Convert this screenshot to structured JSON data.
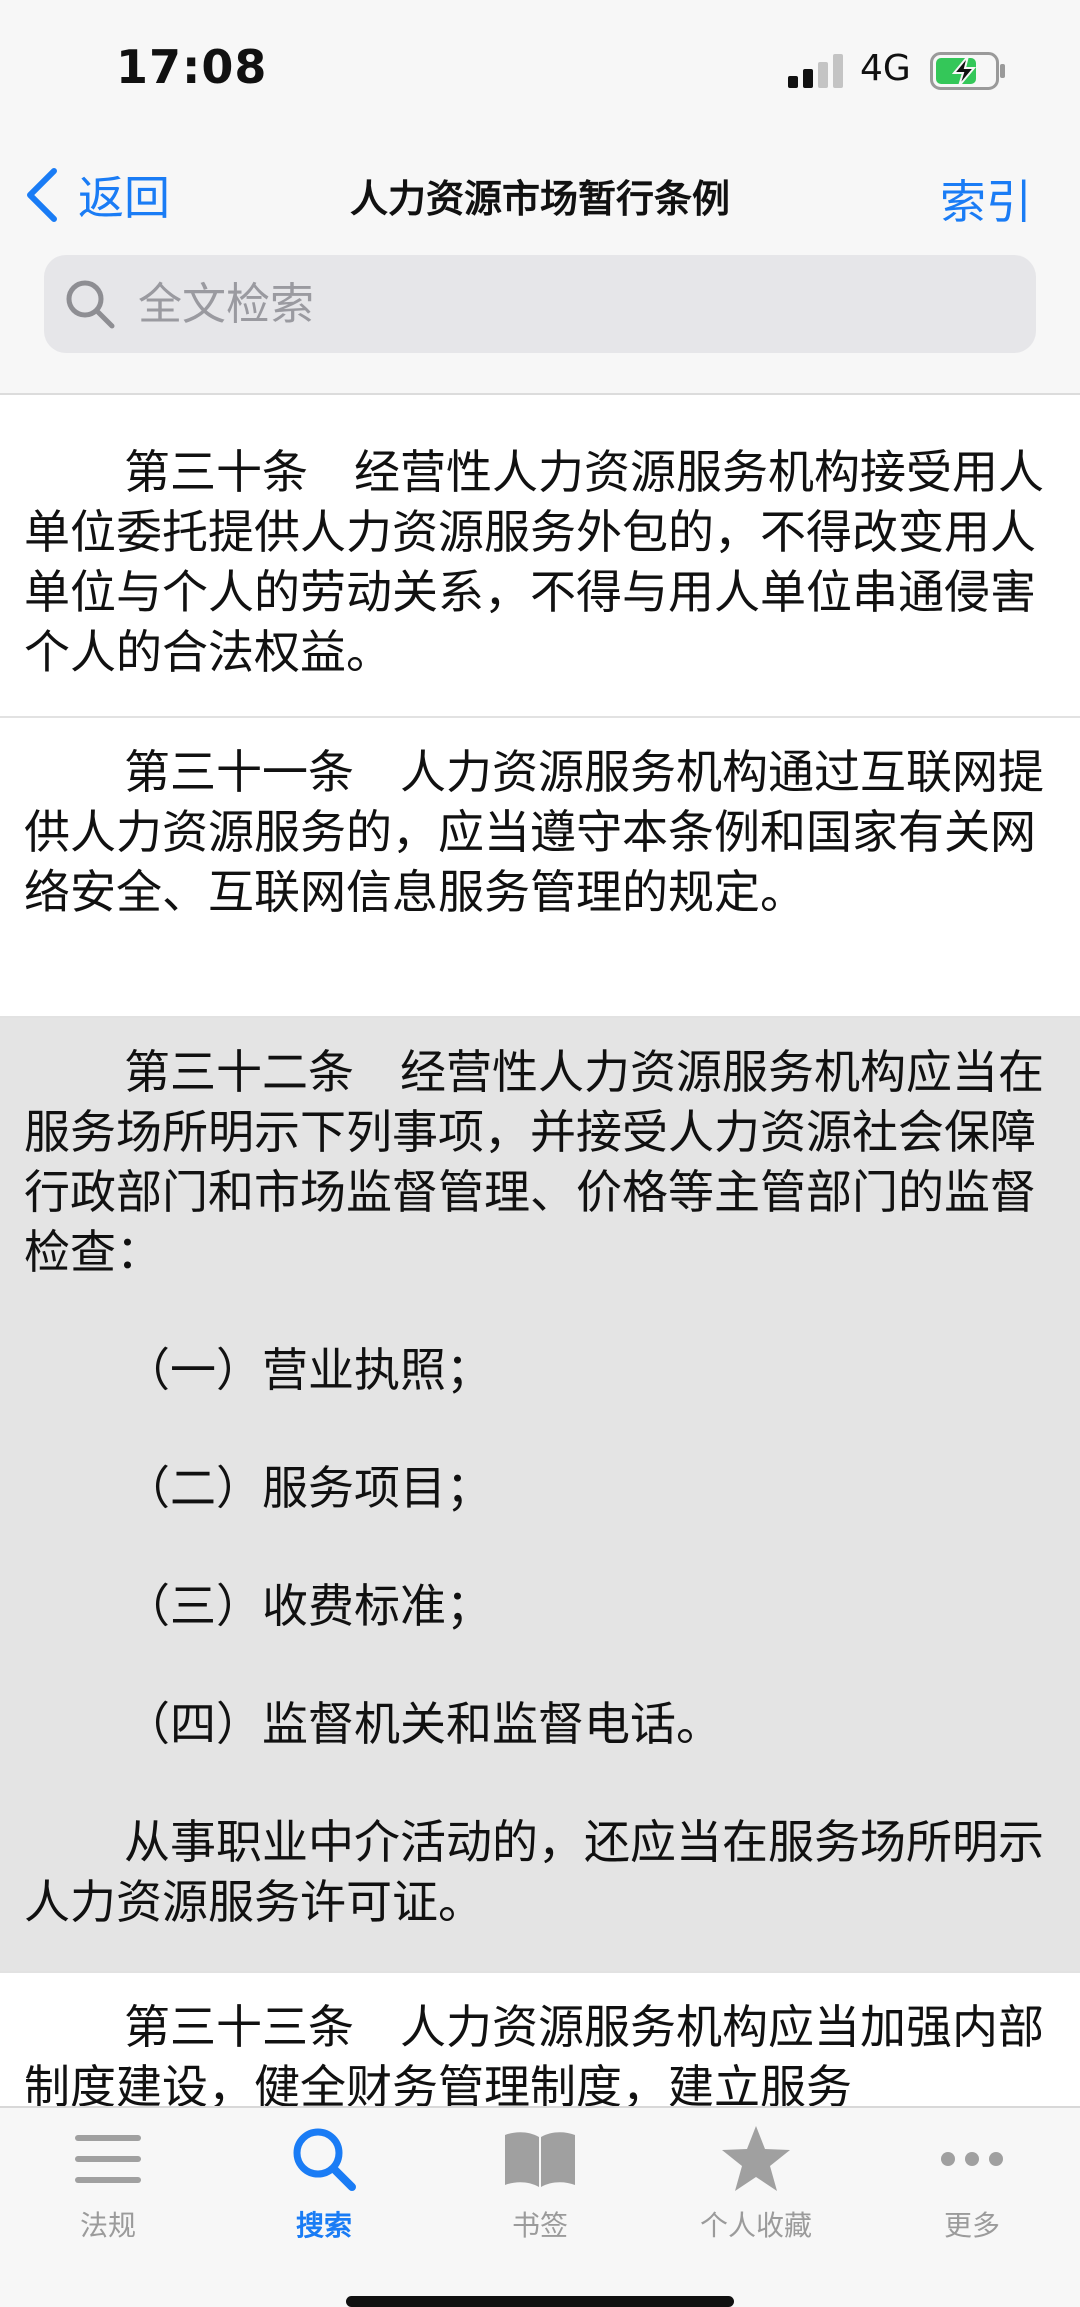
{
  "status_bar": {
    "time": "17:08",
    "network": "4G",
    "icons": [
      "signal-icon",
      "battery-charging-icon"
    ]
  },
  "nav": {
    "back_label": "返回",
    "title": "人力资源市场暂行条例",
    "index_label": "索引",
    "accent_color": "#1a7cf5"
  },
  "search": {
    "placeholder": "全文检索",
    "value": ""
  },
  "articles": [
    {
      "paragraphs": [
        "第三十条　经营性人力资源服务机构接受用人单位委托提供人力资源服务外包的，不得改变用人单位与个人的劳动关系，不得与用人单位串通侵害个人的合法权益。"
      ],
      "highlighted": false
    },
    {
      "paragraphs": [
        "第三十一条　人力资源服务机构通过互联网提供人力资源服务的，应当遵守本条例和国家有关网络安全、互联网信息服务管理的规定。"
      ],
      "highlighted": false
    },
    {
      "paragraphs": [
        "第三十二条　经营性人力资源服务机构应当在服务场所明示下列事项，并接受人力资源社会保障行政部门和市场监督管理、价格等主管部门的监督检查：",
        "（一）营业执照；",
        "（二）服务项目；",
        "（三）收费标准；",
        "（四）监督机关和监督电话。",
        "从事职业中介活动的，还应当在服务场所明示人力资源服务许可证。"
      ],
      "highlighted": true
    },
    {
      "paragraphs": [
        "第三十三条　人力资源服务机构应当加强内部制度建设，健全财务管理制度，建立服务"
      ],
      "highlighted": false
    }
  ],
  "tabs": [
    {
      "label": "法规",
      "icon": "list-icon",
      "active": false
    },
    {
      "label": "搜索",
      "icon": "search-icon",
      "active": true
    },
    {
      "label": "书签",
      "icon": "book-icon",
      "active": false
    },
    {
      "label": "个人收藏",
      "icon": "star-icon",
      "active": false
    },
    {
      "label": "更多",
      "icon": "more-icon",
      "active": false
    }
  ]
}
